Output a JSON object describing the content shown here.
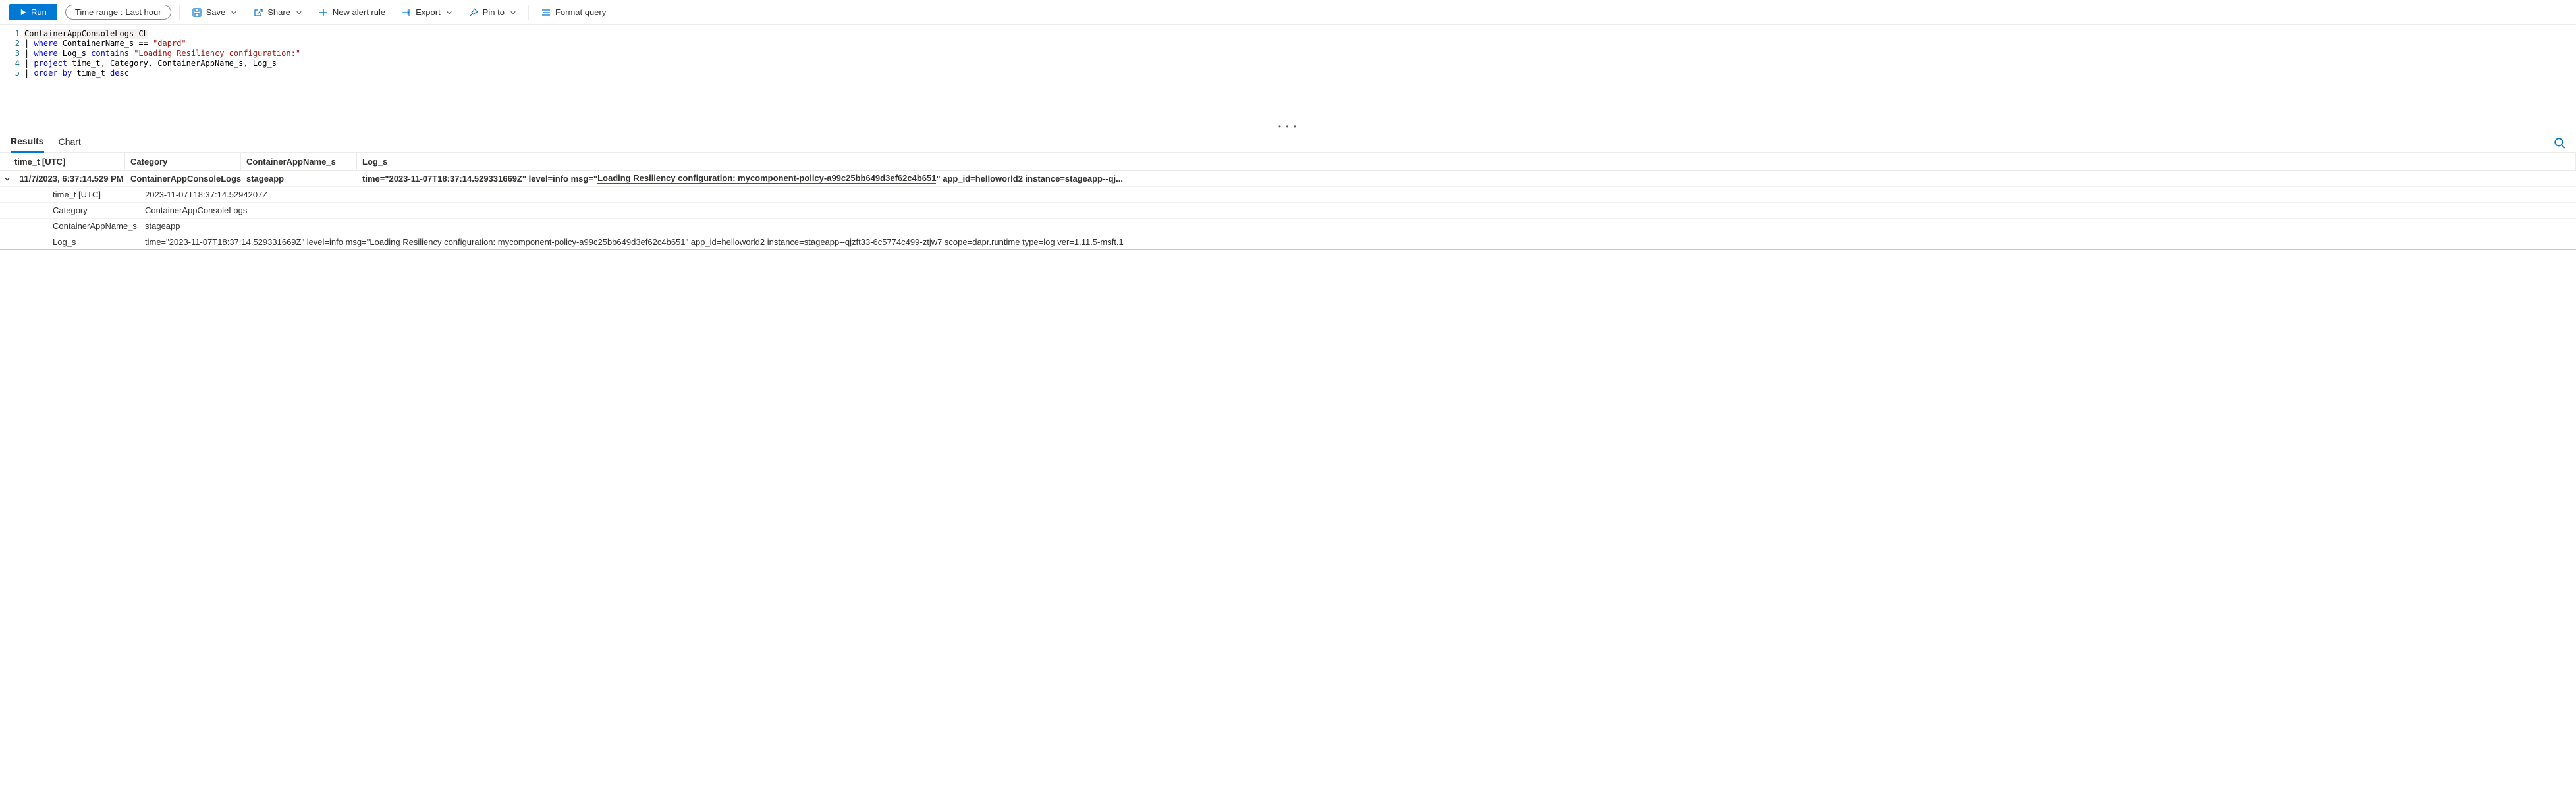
{
  "toolbar": {
    "run": "Run",
    "timerange_label": "Time range :",
    "timerange_value": "Last hour",
    "save": "Save",
    "share": "Share",
    "new_alert": "New alert rule",
    "export": "Export",
    "pin_to": "Pin to",
    "format": "Format query"
  },
  "editor": {
    "lines": [
      {
        "n": 1,
        "segments": [
          {
            "t": "ContainerAppConsoleLogs_CL",
            "cls": "plain row1"
          }
        ]
      },
      {
        "n": 2,
        "segments": [
          {
            "t": "| ",
            "cls": "plain"
          },
          {
            "t": "where",
            "cls": "kw"
          },
          {
            "t": " ContainerName_s == ",
            "cls": "plain"
          },
          {
            "t": "\"daprd\"",
            "cls": "str"
          }
        ]
      },
      {
        "n": 3,
        "segments": [
          {
            "t": "| ",
            "cls": "plain"
          },
          {
            "t": "where",
            "cls": "kw"
          },
          {
            "t": " Log_s ",
            "cls": "plain"
          },
          {
            "t": "contains",
            "cls": "kw"
          },
          {
            "t": " ",
            "cls": "plain"
          },
          {
            "t": "\"Loading Resiliency configuration:\"",
            "cls": "str"
          }
        ]
      },
      {
        "n": 4,
        "segments": [
          {
            "t": "| ",
            "cls": "plain"
          },
          {
            "t": "project",
            "cls": "kw"
          },
          {
            "t": " time_t, Category, ContainerAppName_s, Log_s",
            "cls": "plain"
          }
        ]
      },
      {
        "n": 5,
        "segments": [
          {
            "t": "| ",
            "cls": "plain"
          },
          {
            "t": "order by",
            "cls": "kw"
          },
          {
            "t": " time_t ",
            "cls": "plain"
          },
          {
            "t": "desc",
            "cls": "kw"
          }
        ]
      }
    ]
  },
  "tabs": {
    "results": "Results",
    "chart": "Chart"
  },
  "table": {
    "headers": [
      "time_t [UTC]",
      "Category",
      "ContainerAppName_s",
      "Log_s"
    ],
    "row": {
      "time_display": "11/7/2023, 6:37:14.529 PM",
      "category": "ContainerAppConsoleLogs",
      "appname": "stageapp",
      "log_prefix": "time=\"2023-11-07T18:37:14.529331669Z\" level=info msg=\"",
      "log_highlight": "Loading Resiliency configuration: mycomponent-policy-a99c25bb649d3ef62c4b651",
      "log_suffix": "\" app_id=helloworld2 instance=stageapp--qj..."
    },
    "details": [
      {
        "k": "time_t [UTC]",
        "v": "2023-11-07T18:37:14.5294207Z"
      },
      {
        "k": "Category",
        "v": "ContainerAppConsoleLogs"
      },
      {
        "k": "ContainerAppName_s",
        "v": "stageapp"
      },
      {
        "k": "Log_s",
        "v": "time=\"2023-11-07T18:37:14.529331669Z\" level=info msg=\"Loading Resiliency configuration: mycomponent-policy-a99c25bb649d3ef62c4b651\" app_id=helloworld2 instance=stageapp--qjzft33-6c5774c499-ztjw7 scope=dapr.runtime type=log ver=1.11.5-msft.1"
      }
    ]
  }
}
